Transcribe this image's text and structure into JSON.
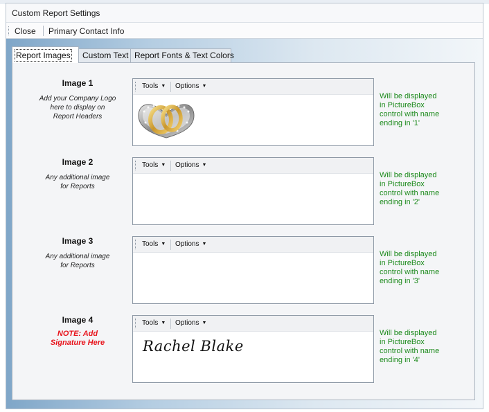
{
  "window": {
    "title": "Custom Report Settings"
  },
  "menu": {
    "close": "Close",
    "primary_contact": "Primary Contact Info"
  },
  "tabs": [
    "Report Images",
    "Custom Text",
    "Report Fonts & Text Colors"
  ],
  "toolbar": {
    "tools": "Tools",
    "options": "Options"
  },
  "images": [
    {
      "title": "Image 1",
      "desc": "Add your Company Logo\nhere to display on\nReport Headers",
      "side": "Will be displayed\nin PictureBox\ncontrol with name\nending in '1'"
    },
    {
      "title": "Image 2",
      "desc": "Any additional image\nfor Reports",
      "side": "Will be displayed\nin PictureBox\ncontrol with name\nending in '2'"
    },
    {
      "title": "Image 3",
      "desc": "Any additional image\nfor Reports",
      "side": "Will be displayed\nin PictureBox\ncontrol with name\nending in '3'"
    },
    {
      "title": "Image 4",
      "desc": "NOTE:  Add\nSignature Here",
      "side": "Will be displayed\nin PictureBox\ncontrol with name\nending in '4'",
      "signature": "Rachel Blake"
    }
  ],
  "colors": {
    "note": "#e8141c",
    "side_text": "#1c8a1c",
    "accent": "#7fa6c8"
  },
  "icons": [
    "dropdown-caret-icon",
    "toolbar-grip-icon",
    "wedding-rings-image"
  ]
}
